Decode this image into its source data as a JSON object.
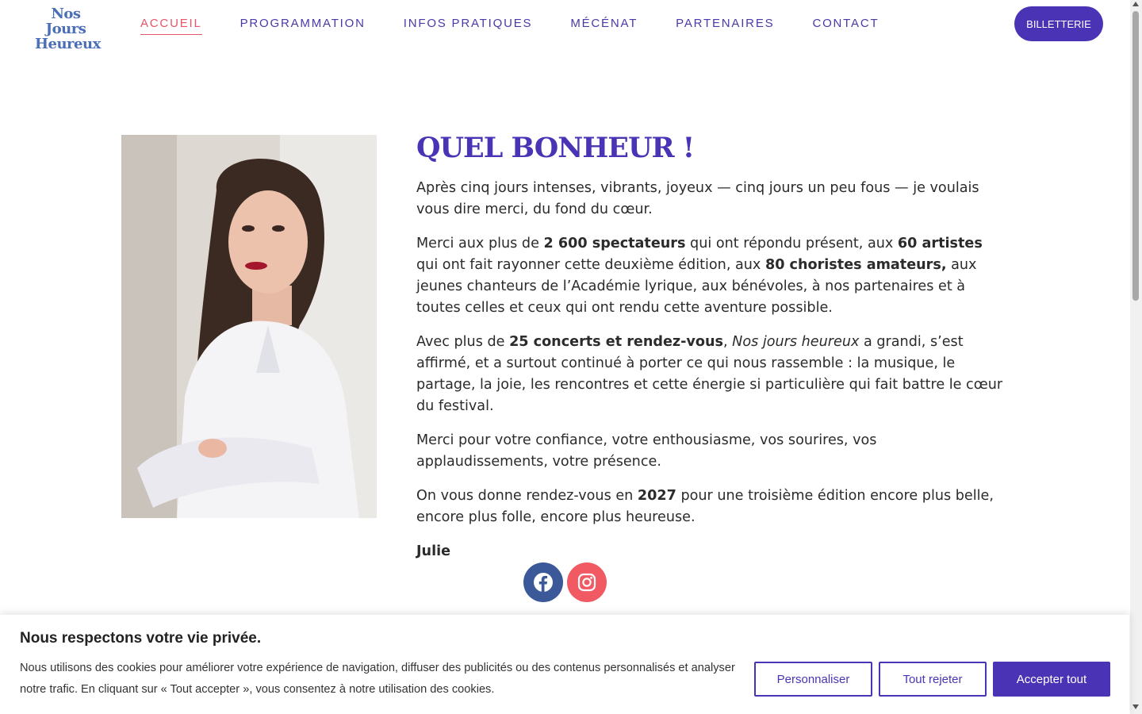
{
  "header": {
    "logo_line1": "Nos Jours",
    "logo_line2": "Heureux",
    "nav": [
      {
        "label": "ACCUEIL",
        "active": true
      },
      {
        "label": "PROGRAMMATION",
        "active": false
      },
      {
        "label": "INFOS PRATIQUES",
        "active": false
      },
      {
        "label": "MÉCÉNAT",
        "active": false
      },
      {
        "label": "PARTENAIRES",
        "active": false
      },
      {
        "label": "CONTACT",
        "active": false
      }
    ],
    "ticket_button": "BILLETTERIE"
  },
  "main": {
    "title": "QUEL BONHEUR !",
    "p1": "Après cinq jours intenses, vibrants, joyeux — cinq jours un peu fous — je voulais vous dire merci, du fond du cœur.",
    "p2_a": "Merci aux plus de ",
    "p2_b": "2 600 spectateurs",
    "p2_c": " qui ont répondu présent, aux ",
    "p2_d": "60 artistes",
    "p2_e": " qui ont fait rayonner cette deuxième édition, aux ",
    "p2_f": "80 choristes amateurs,",
    "p2_g": " aux jeunes chanteurs de l’Académie lyrique, aux bénévoles, à nos partenaires et à toutes celles et ceux qui ont rendu cette aventure possible.",
    "p3_a": "Avec plus de ",
    "p3_b": "25 concerts et rendez-vous",
    "p3_c": ", ",
    "p3_d": "Nos jours heureux",
    "p3_e": " a grandi, s’est affirmé, et a surtout continué à porter ce qui nous rassemble : la musique, le partage, la joie, les rencontres et cette énergie si particulière qui fait battre le cœur du festival.",
    "p4": "Merci pour votre confiance, votre enthousiasme, vos sourires, vos applaudissements, votre présence.",
    "p5_a": "On vous donne rendez-vous en ",
    "p5_b": "2027",
    "p5_c": " pour une troisième édition encore plus belle, encore plus folle, encore plus heureuse.",
    "signature": "Julie"
  },
  "social": {
    "facebook_icon": "facebook-icon",
    "instagram_icon": "instagram-icon",
    "facebook_color": "#3b5998",
    "instagram_color": "#f15a63"
  },
  "cookie": {
    "title": "Nous respectons votre vie privée.",
    "text": "Nous utilisons des cookies pour améliorer votre expérience de navigation, diffuser des publicités ou des contenus personnalisés et analyser notre trafic. En cliquant sur « Tout accepter », vous consentez à notre utilisation des cookies.",
    "customize_label": "Personnaliser",
    "reject_label": "Tout rejeter",
    "accept_label": "Accepter tout"
  },
  "colors": {
    "accent": "#4a34b5",
    "nav_text": "#4a3aa8",
    "active_nav": "#e8556a",
    "logo": "#4a6fb8"
  }
}
